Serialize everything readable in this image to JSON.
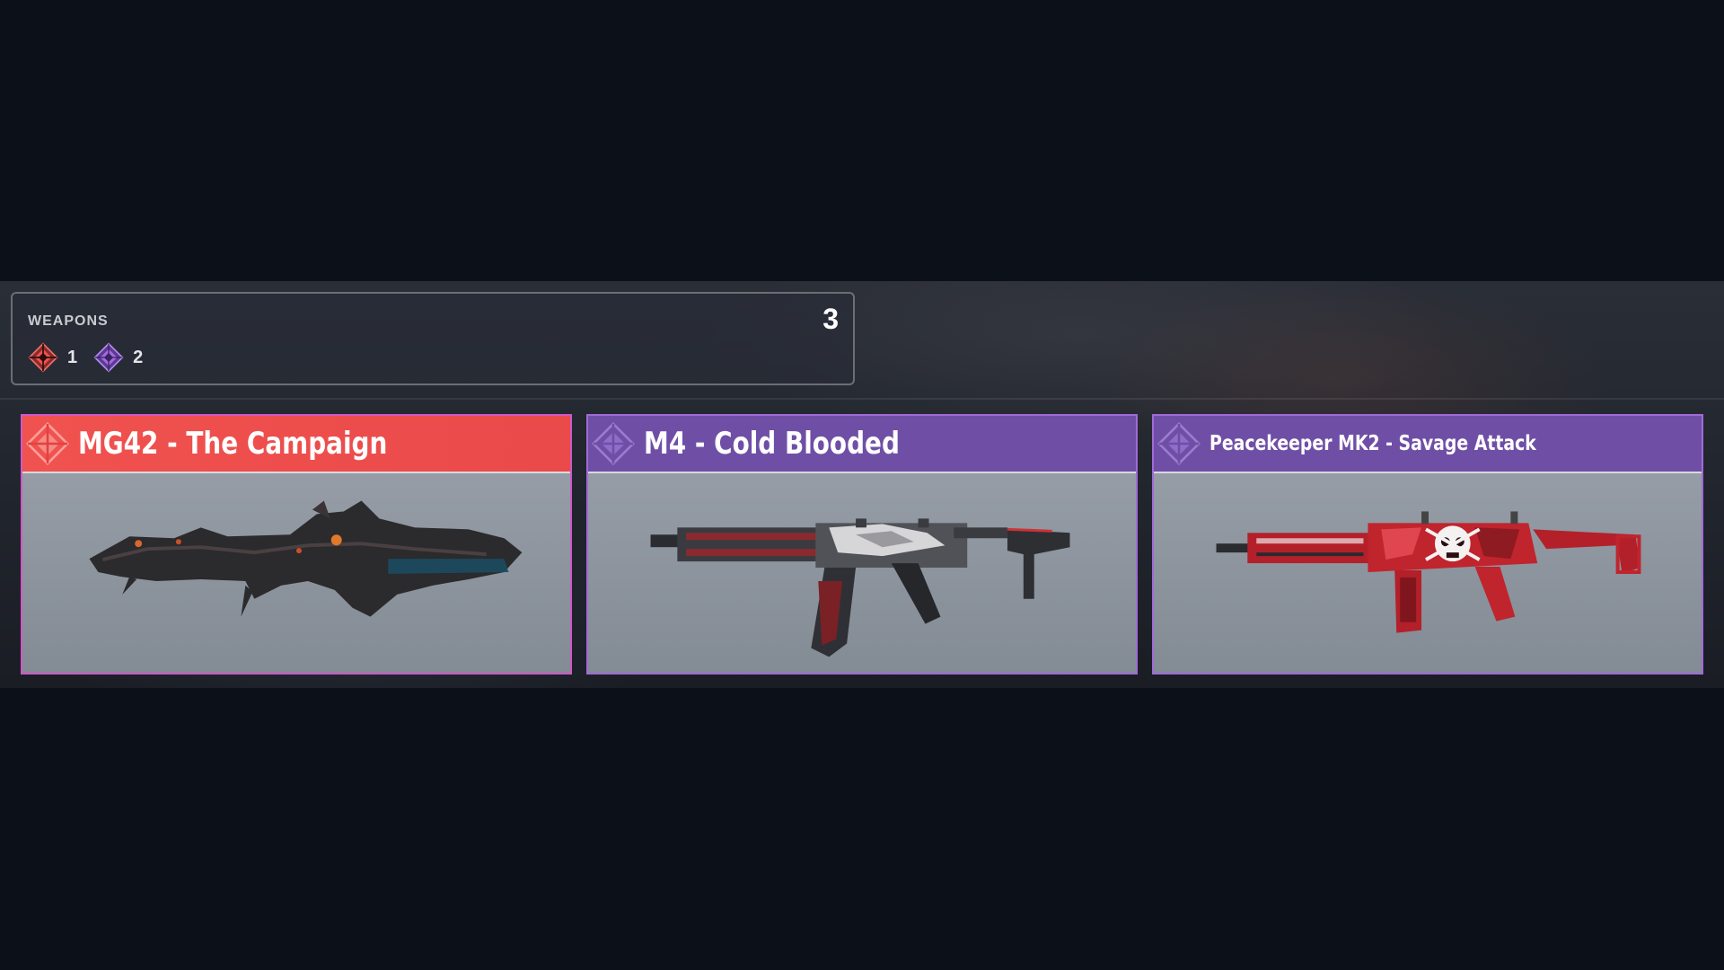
{
  "summary": {
    "title": "WEAPONS",
    "total": "3",
    "rarities": [
      {
        "icon": "legendary-rarity-icon",
        "color": "#f0524f",
        "count": "1"
      },
      {
        "icon": "epic-rarity-icon",
        "color": "#a46be0",
        "count": "2"
      }
    ]
  },
  "cards": [
    {
      "name": "MG42 - The Campaign",
      "rarity": "legendary",
      "header_color": "#f0524f"
    },
    {
      "name": "M4 - Cold Blooded",
      "rarity": "epic",
      "header_color": "#6f4fa6"
    },
    {
      "name": "Peacekeeper MK2 - Savage Attack",
      "rarity": "epic",
      "header_color": "#6f4fa6"
    }
  ]
}
